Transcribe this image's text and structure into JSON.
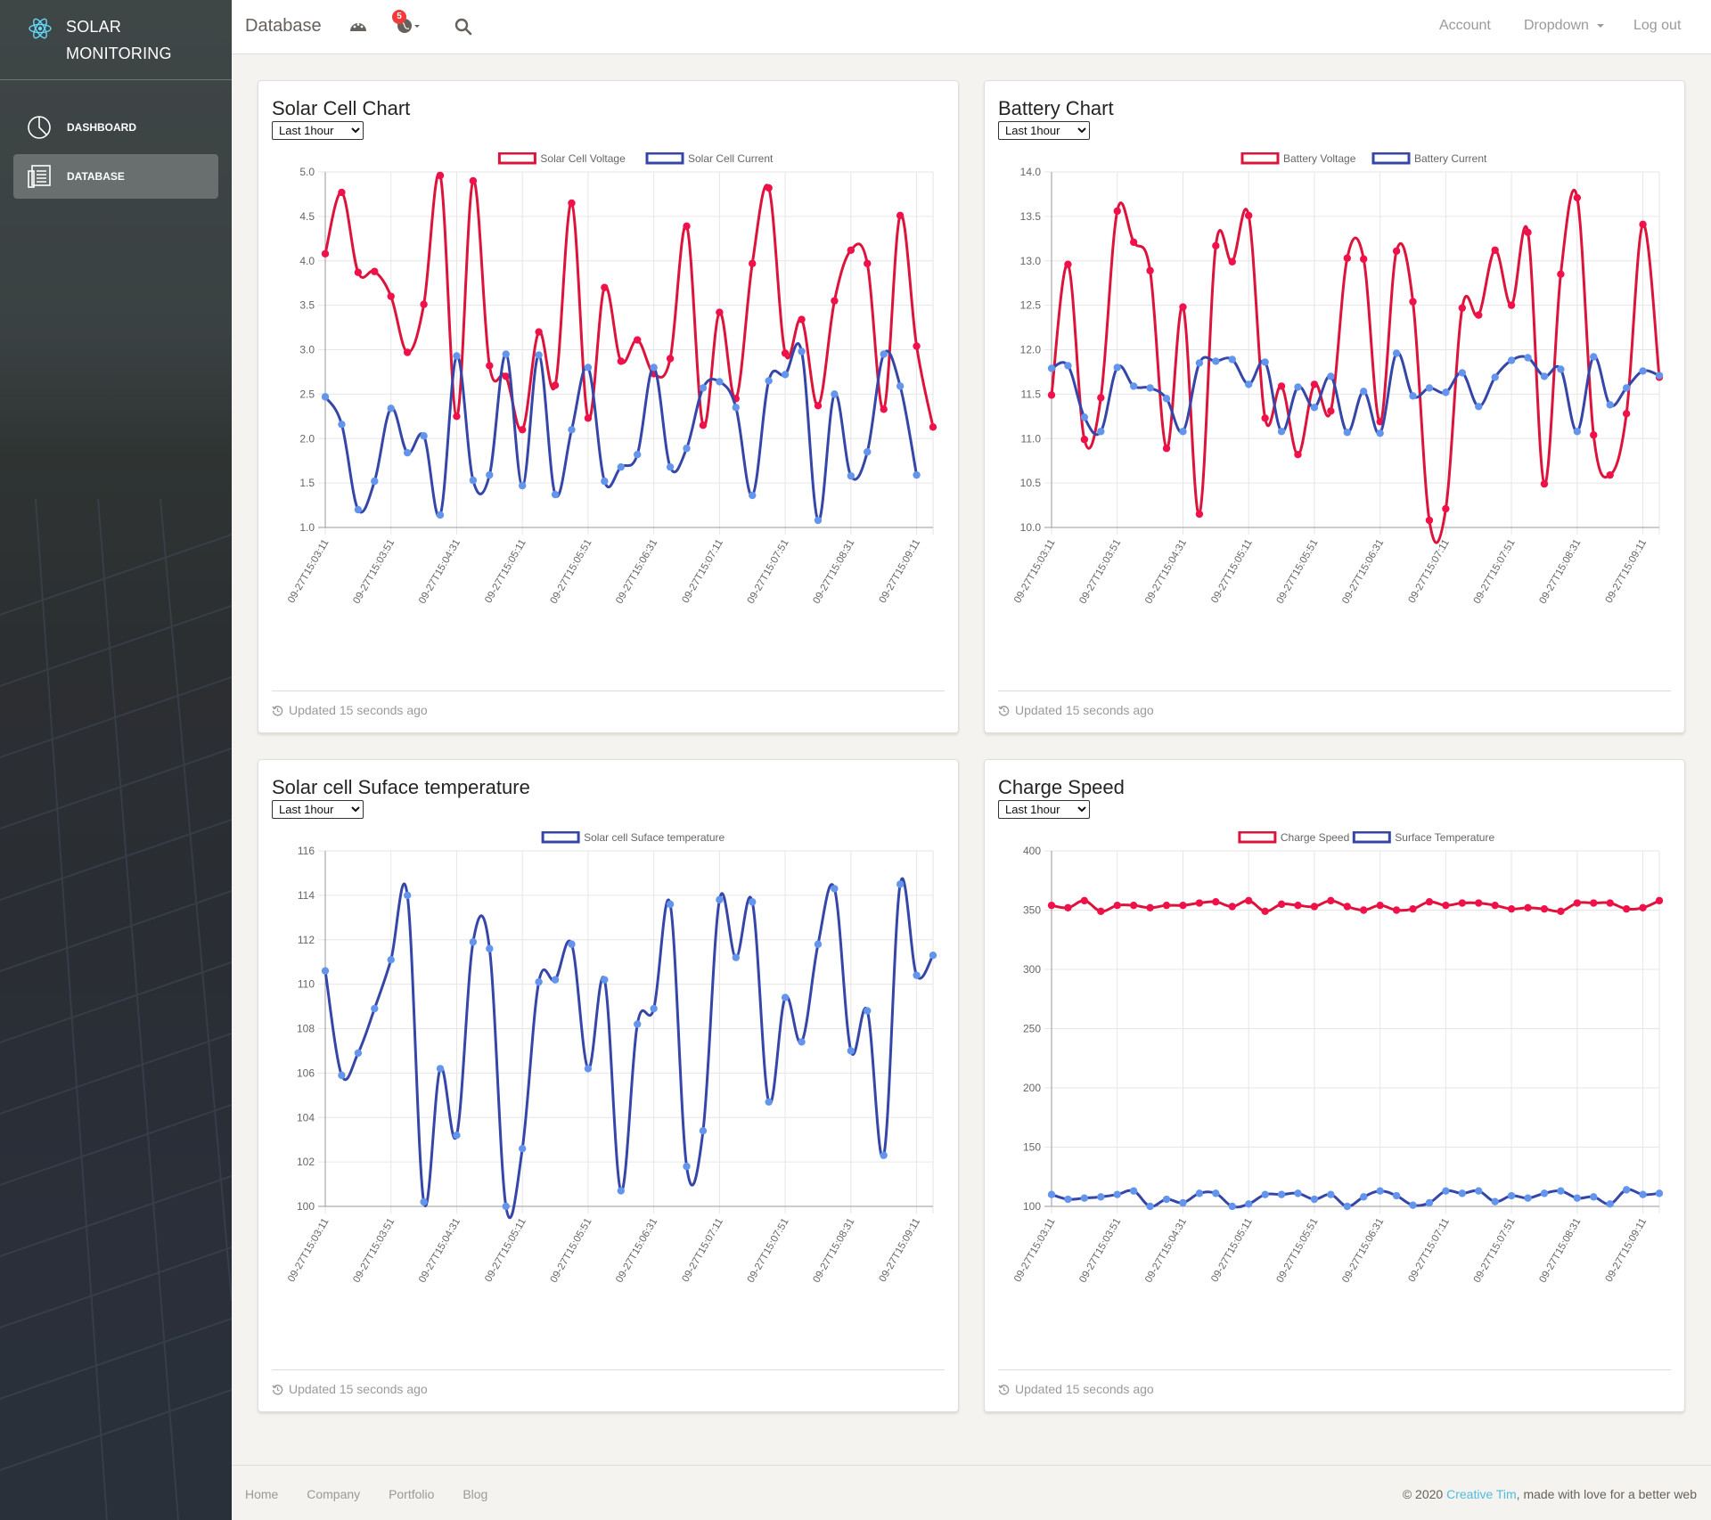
{
  "sidebar": {
    "brand_line1": "SOLAR",
    "brand_line2": "MONITORING",
    "logo_icon": "react-atom-icon",
    "items": [
      {
        "label": "DASHBOARD",
        "icon": "pie-chart-icon",
        "active": false
      },
      {
        "label": "DATABASE",
        "icon": "database-list-icon",
        "active": true
      }
    ]
  },
  "topnav": {
    "title": "Database",
    "icons": [
      "palette-icon",
      "globe-icon",
      "search-icon"
    ],
    "notification_count": "5",
    "account": "Account",
    "dropdown": "Dropdown",
    "logout": "Log out"
  },
  "colors": {
    "red": "#dc143c",
    "blue": "#3546a8",
    "blue_point": "#6495ed",
    "red_point": "#f0104a"
  },
  "cards": [
    {
      "title": "Solar Cell Chart",
      "range": "Last 1hour",
      "updated": "Updated 15 seconds ago"
    },
    {
      "title": "Battery Chart",
      "range": "Last 1hour",
      "updated": "Updated 15 seconds ago"
    },
    {
      "title": "Solar cell Suface temperature",
      "range": "Last 1hour",
      "updated": "Updated 15 seconds ago"
    },
    {
      "title": "Charge Speed",
      "range": "Last 1hour",
      "updated": "Updated 15 seconds ago"
    }
  ],
  "chart_data": [
    {
      "type": "line",
      "x_tick_labels": [
        "09-27T15:03:11",
        "09-27T15:03:51",
        "09-27T15:04:31",
        "09-27T15:05:11",
        "09-27T15:05:51",
        "09-27T15:06:31",
        "09-27T15:07:11",
        "09-27T15:07:51",
        "09-27T15:08:31",
        "09-27T15:09:11"
      ],
      "ylim": [
        1.0,
        5.0
      ],
      "yticks": [
        "1.0",
        "1.5",
        "2.0",
        "2.5",
        "3.0",
        "3.5",
        "4.0",
        "4.5",
        "5.0"
      ],
      "series": [
        {
          "name": "Solar Cell Voltage",
          "color": "#dc143c",
          "values": [
            4.08,
            4.77,
            3.87,
            3.88,
            3.6,
            2.97,
            3.51,
            4.96,
            2.25,
            4.9,
            2.82,
            2.7,
            2.1,
            3.2,
            2.6,
            4.65,
            2.23,
            3.7,
            2.87,
            3.11,
            2.73,
            2.9,
            4.39,
            2.15,
            3.42,
            2.45,
            3.97,
            4.82,
            2.96,
            3.34,
            2.37,
            3.55,
            4.12,
            3.97,
            2.33,
            4.51,
            3.04,
            2.13
          ]
        },
        {
          "name": "Solar Cell Current",
          "color": "#3546a8",
          "values": [
            2.47,
            2.16,
            1.2,
            1.52,
            2.34,
            1.84,
            2.03,
            1.14,
            2.93,
            1.53,
            1.59,
            2.95,
            1.47,
            2.94,
            1.37,
            2.1,
            2.8,
            1.52,
            1.68,
            1.82,
            2.8,
            1.68,
            1.89,
            2.57,
            2.64,
            2.35,
            1.36,
            2.65,
            2.72,
            2.98,
            1.08,
            2.5,
            1.58,
            1.85,
            2.95,
            2.59,
            1.59
          ]
        }
      ]
    },
    {
      "type": "line",
      "x_tick_labels": [
        "09-27T15:03:11",
        "09-27T15:03:51",
        "09-27T15:04:31",
        "09-27T15:05:11",
        "09-27T15:05:51",
        "09-27T15:06:31",
        "09-27T15:07:11",
        "09-27T15:07:51",
        "09-27T15:08:31",
        "09-27T15:09:11"
      ],
      "ylim": [
        10.0,
        14.0
      ],
      "yticks": [
        "10.0",
        "10.5",
        "11.0",
        "11.5",
        "12.0",
        "12.5",
        "13.0",
        "13.5",
        "14.0"
      ],
      "series": [
        {
          "name": "Battery Voltage",
          "color": "#dc143c",
          "values": [
            11.49,
            12.96,
            10.99,
            11.46,
            13.56,
            13.21,
            12.89,
            10.89,
            12.48,
            10.15,
            13.17,
            12.99,
            13.51,
            11.23,
            11.59,
            10.82,
            11.61,
            11.31,
            13.03,
            13.02,
            11.19,
            13.11,
            12.54,
            10.08,
            10.21,
            12.47,
            12.39,
            13.12,
            12.5,
            13.32,
            10.49,
            12.85,
            13.71,
            11.04,
            10.59,
            11.28,
            13.41,
            11.69
          ]
        },
        {
          "name": "Battery Current",
          "color": "#3546a8",
          "values": [
            11.79,
            11.82,
            11.24,
            11.08,
            11.8,
            11.59,
            11.57,
            11.45,
            11.08,
            11.85,
            11.87,
            11.89,
            11.61,
            11.86,
            11.08,
            11.58,
            11.35,
            11.7,
            11.07,
            11.53,
            11.06,
            11.96,
            11.48,
            11.57,
            11.52,
            11.74,
            11.36,
            11.69,
            11.88,
            11.91,
            11.7,
            11.78,
            11.08,
            11.92,
            11.38,
            11.57,
            11.76,
            11.71
          ]
        }
      ]
    },
    {
      "type": "line",
      "x_tick_labels": [
        "09-27T15:03:11",
        "09-27T15:03:51",
        "09-27T15:04:31",
        "09-27T15:05:11",
        "09-27T15:05:51",
        "09-27T15:06:31",
        "09-27T15:07:11",
        "09-27T15:07:51",
        "09-27T15:08:31",
        "09-27T15:09:11"
      ],
      "ylim": [
        100,
        116
      ],
      "yticks": [
        "100",
        "102",
        "104",
        "106",
        "108",
        "110",
        "112",
        "114",
        "116"
      ],
      "series": [
        {
          "name": "Solar cell Suface temperature",
          "color": "#3546a8",
          "values": [
            110.6,
            105.9,
            106.9,
            108.9,
            111.1,
            114.0,
            100.2,
            106.2,
            103.2,
            111.9,
            111.6,
            100.0,
            102.6,
            110.1,
            110.2,
            111.8,
            106.2,
            110.2,
            100.7,
            108.2,
            108.9,
            113.6,
            101.8,
            103.4,
            113.8,
            111.2,
            113.7,
            104.7,
            109.4,
            107.4,
            111.8,
            114.3,
            107.0,
            108.8,
            102.3,
            114.5,
            110.4,
            111.3
          ]
        }
      ]
    },
    {
      "type": "line",
      "x_tick_labels": [
        "09-27T15:03:11",
        "09-27T15:03:51",
        "09-27T15:04:31",
        "09-27T15:05:11",
        "09-27T15:05:51",
        "09-27T15:06:31",
        "09-27T15:07:11",
        "09-27T15:07:51",
        "09-27T15:08:31",
        "09-27T15:09:11"
      ],
      "ylim": [
        100,
        400
      ],
      "yticks": [
        "100",
        "150",
        "200",
        "250",
        "300",
        "350",
        "400"
      ],
      "series": [
        {
          "name": "Charge Speed",
          "color": "#dc143c",
          "values": [
            354,
            352,
            358,
            349,
            354,
            354,
            352,
            354,
            354,
            356,
            357,
            353,
            358,
            349,
            355,
            354,
            353,
            358,
            353,
            350,
            354,
            350,
            351,
            357,
            354,
            356,
            356,
            354,
            351,
            352,
            351,
            349,
            356,
            356,
            356,
            351,
            352,
            358
          ]
        },
        {
          "name": "Surface Temperature",
          "color": "#3546a8",
          "values": [
            110,
            106,
            107,
            108,
            110,
            113,
            100,
            106,
            103,
            111,
            111,
            100,
            102,
            110,
            110,
            111,
            106,
            110,
            100,
            108,
            113,
            109,
            101,
            103,
            113,
            111,
            113,
            104,
            109,
            107,
            111,
            113,
            107,
            108,
            102,
            114,
            110,
            111
          ]
        }
      ]
    }
  ],
  "footer": {
    "links": [
      "Home",
      "Company",
      "Portfolio",
      "Blog"
    ],
    "copyright_prefix": "© 2020 ",
    "copyright_link": "Creative Tim",
    "copyright_suffix": ", made with love for a better web"
  }
}
